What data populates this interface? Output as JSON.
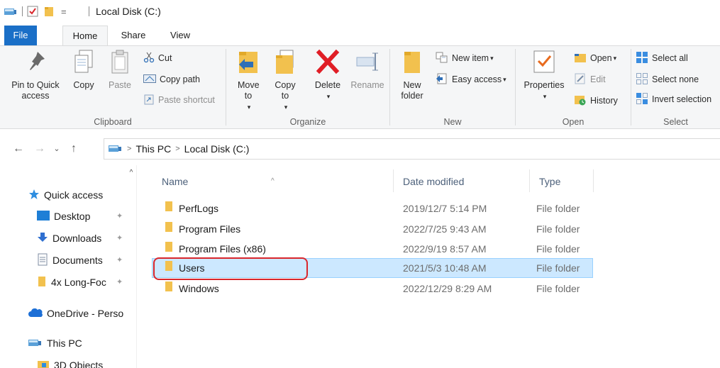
{
  "window": {
    "title": "Local Disk (C:)",
    "qat_dropdown": "="
  },
  "tabs": [
    {
      "label": "File"
    },
    {
      "label": "Home"
    },
    {
      "label": "Share"
    },
    {
      "label": "View"
    }
  ],
  "ribbon": {
    "clipboard": {
      "label": "Clipboard",
      "pin_to_quick_access": "Pin to Quick access",
      "copy": "Copy",
      "paste": "Paste",
      "cut": "Cut",
      "copy_path": "Copy path",
      "paste_shortcut": "Paste shortcut"
    },
    "organize": {
      "label": "Organize",
      "move_to": "Move to",
      "copy_to": "Copy to",
      "delete": "Delete",
      "rename": "Rename"
    },
    "new": {
      "label": "New",
      "new_folder": "New folder",
      "new_item": "New item",
      "easy_access": "Easy access"
    },
    "open": {
      "label": "Open",
      "properties": "Properties",
      "open": "Open",
      "edit": "Edit",
      "history": "History"
    },
    "select": {
      "label": "Select",
      "select_all": "Select all",
      "select_none": "Select none",
      "invert_selection": "Invert selection"
    }
  },
  "address": {
    "crumbs": [
      "This PC",
      "Local Disk (C:)"
    ]
  },
  "navpane": {
    "items": [
      {
        "label": "Quick access",
        "icon": "star-icon"
      },
      {
        "label": "Desktop",
        "icon": "desktop-icon",
        "pinned": true
      },
      {
        "label": "Downloads",
        "icon": "download-icon",
        "pinned": true
      },
      {
        "label": "Documents",
        "icon": "documents-icon",
        "pinned": true
      },
      {
        "label": "4x Long-Foc",
        "icon": "folder-icon",
        "pinned": true
      },
      {
        "label": "OneDrive - Perso",
        "icon": "cloud-icon"
      },
      {
        "label": "This PC",
        "icon": "computer-icon"
      },
      {
        "label": "3D Objects",
        "icon": "3d-objects-icon"
      }
    ]
  },
  "filelist": {
    "columns": [
      "Name",
      "Date modified",
      "Type"
    ],
    "rows": [
      {
        "name": "PerfLogs",
        "date": "2019/12/7 5:14 PM",
        "type": "File folder"
      },
      {
        "name": "Program Files",
        "date": "2022/7/25 9:43 AM",
        "type": "File folder"
      },
      {
        "name": "Program Files (x86)",
        "date": "2022/9/19 8:57 AM",
        "type": "File folder"
      },
      {
        "name": "Users",
        "date": "2021/5/3 10:48 AM",
        "type": "File folder",
        "selected": true
      },
      {
        "name": "Windows",
        "date": "2022/12/29 8:29 AM",
        "type": "File folder"
      }
    ]
  },
  "colors": {
    "accent": "#1a6fc7",
    "selection": "#cce8ff",
    "folder": "#f2c14e",
    "highlight": "#d9262c"
  }
}
